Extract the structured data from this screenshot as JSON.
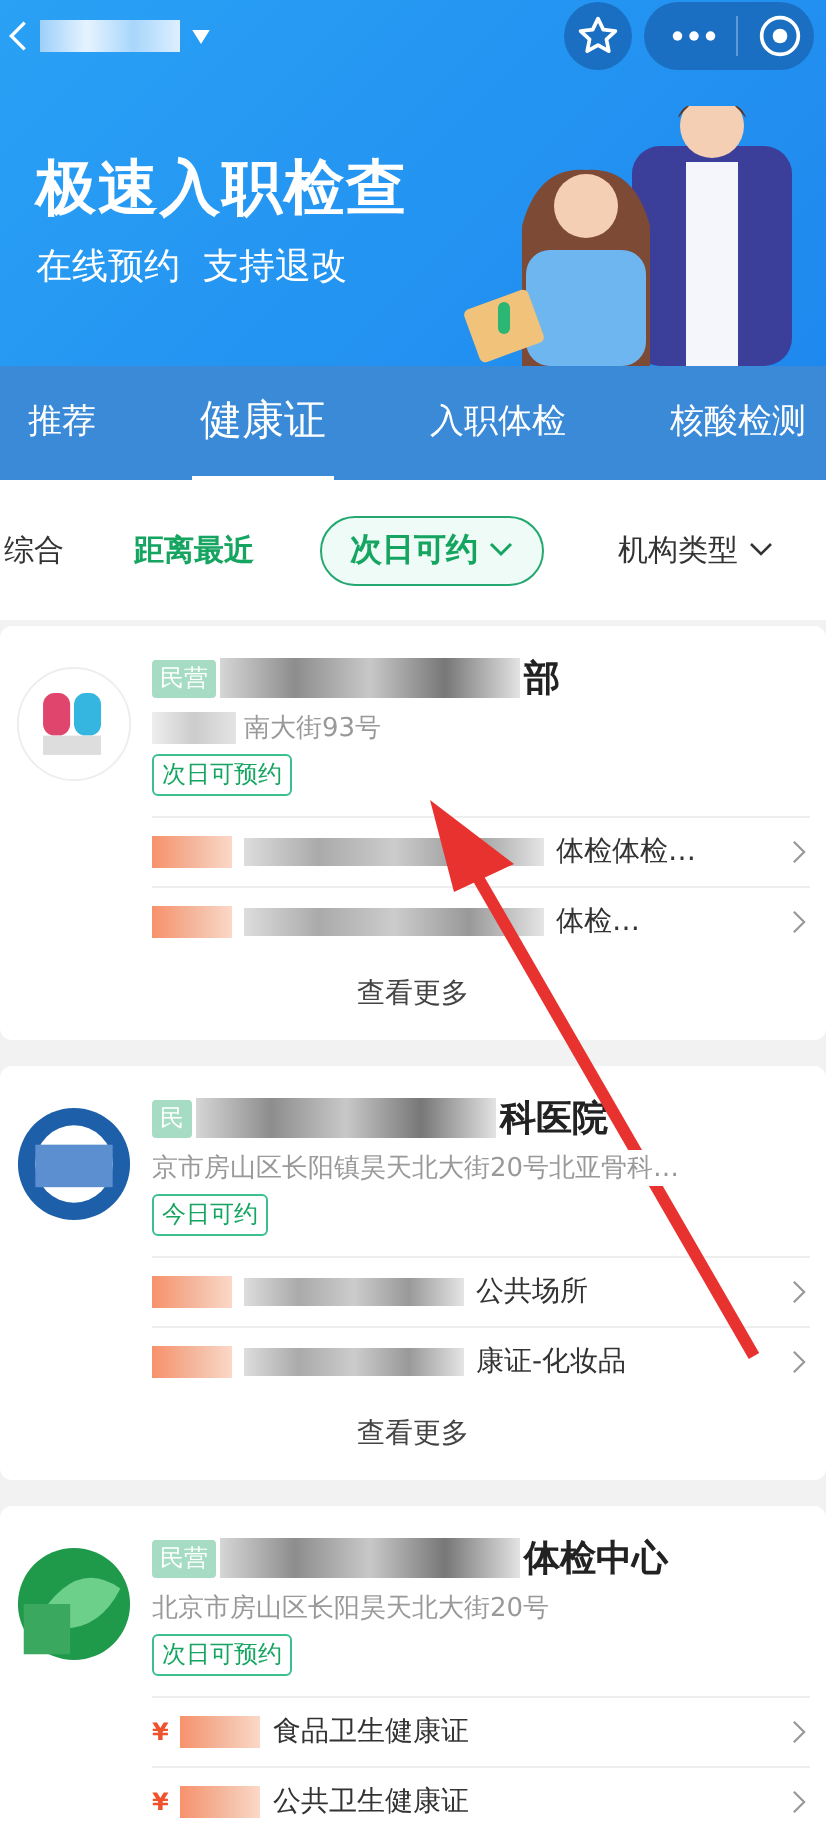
{
  "banner": {
    "title": "极速入职检查",
    "subtitle": "在线预约  支持退改"
  },
  "tabs": [
    {
      "label": "推荐",
      "selected": false
    },
    {
      "label": "健康证",
      "selected": true
    },
    {
      "label": "入职体检",
      "selected": false
    },
    {
      "label": "核酸检测",
      "selected": false
    }
  ],
  "filters": [
    {
      "label": "综合",
      "kind": "text",
      "selected": false
    },
    {
      "label": "距离最近",
      "kind": "text",
      "selected": true
    },
    {
      "label": "次日可约",
      "kind": "chip",
      "selected": true
    },
    {
      "label": "机构类型",
      "kind": "dropdown",
      "selected": false
    }
  ],
  "cards": [
    {
      "kind": "columns",
      "badge": "民营",
      "name": "部",
      "address": "南大街93号",
      "tag": "次日可预约",
      "items": [
        {
          "name": "体检体检…"
        },
        {
          "name": "体检…"
        }
      ],
      "more": "查看更多"
    },
    {
      "kind": "ring",
      "badge": "民",
      "name": "科医院",
      "address": "京市房山区长阳镇昊天北大街20号北亚骨科…",
      "tag": "今日可约",
      "items": [
        {
          "name": "公共场所"
        },
        {
          "name": "康证-化妆品"
        }
      ],
      "more": "查看更多"
    },
    {
      "kind": "leaf",
      "badge": "民营",
      "name": "体检中心",
      "address": "北京市房山区长阳昊天北大街20号",
      "tag": "次日可预约",
      "items": [
        {
          "name": "食品卫生健康证",
          "price_symbol": "¥"
        },
        {
          "name": "公共卫生健康证",
          "price_symbol": "¥"
        }
      ]
    }
  ]
}
